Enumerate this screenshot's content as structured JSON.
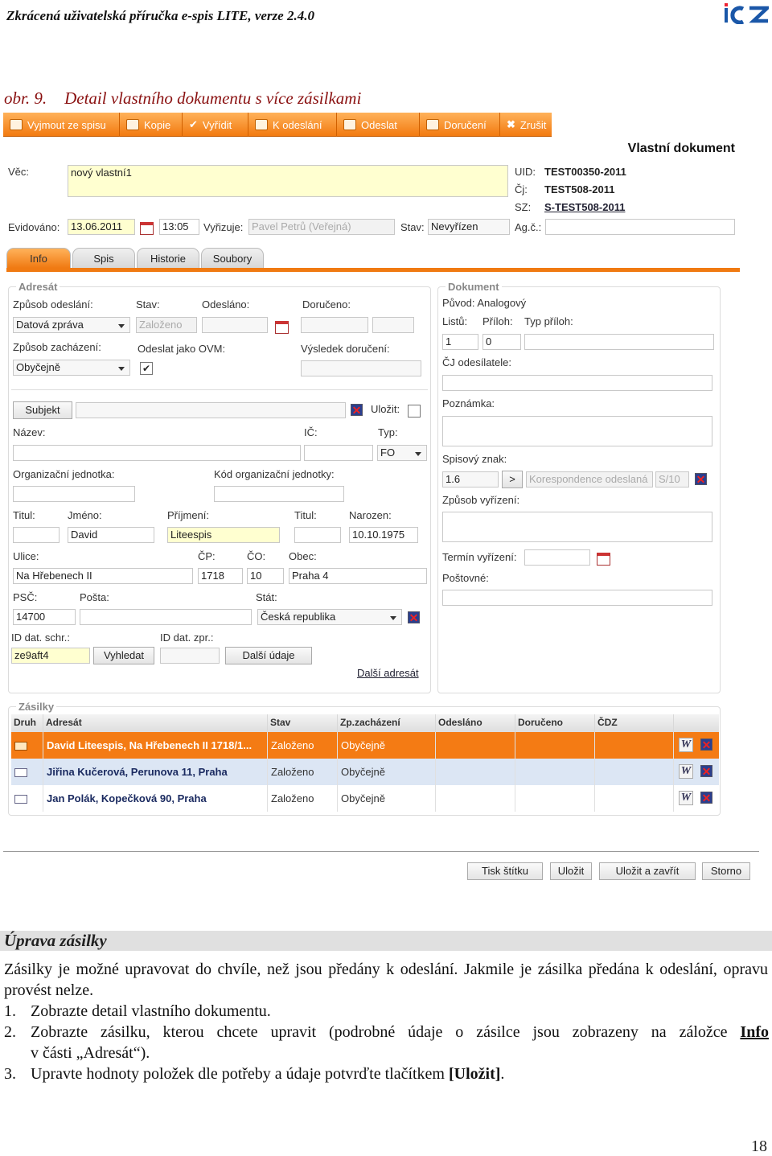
{
  "header": {
    "title": "Zkrácená uživatelská příručka e-spis LITE, verze 2.4.0",
    "logo": "ICZ"
  },
  "figure": {
    "number": "obr. 9.",
    "caption": "Detail vlastního dokumentu s více zásilkami"
  },
  "toolbar": [
    "Vyjmout ze spisu",
    "Kopie",
    "Vyřídit",
    "K odeslání",
    "Odeslat",
    "Doručení",
    "Zrušit"
  ],
  "doc": {
    "heading": "Vlastní dokument",
    "vec_label": "Věc:",
    "vec": "nový vlastní1",
    "uid_label": "UID:",
    "uid": "TEST00350-2011",
    "cj_label": "Čj:",
    "cj": "TEST508-2011",
    "sz_label": "SZ:",
    "sz": "S-TEST508-2011",
    "evid_label": "Evidováno:",
    "evid_date": "13.06.2011",
    "evid_time": "13:05",
    "vyrizuje_label": "Vyřizuje:",
    "vyrizuje": "Pavel Petrů (Veřejná)",
    "stav_label": "Stav:",
    "stav": "Nevyřízen",
    "agc_label": "Ag.č.:"
  },
  "tabs": [
    "Info",
    "Spis",
    "Historie",
    "Soubory"
  ],
  "adresat": {
    "title": "Adresát",
    "zpusob_odeslani_label": "Způsob odeslání:",
    "zpusob_odeslani": "Datová zpráva",
    "stav_label": "Stav:",
    "stav": "Založeno",
    "odeslano_label": "Odesláno:",
    "doruceno_label": "Doručeno:",
    "zpusob_zachazeni_label": "Způsob zacházení:",
    "zpusob_zachazeni": "Obyčejně",
    "ovm_label": "Odeslat jako OVM:",
    "vysledek_label": "Výsledek doručení:",
    "subjekt_btn": "Subjekt",
    "ulozit_label": "Uložit:",
    "nazev_label": "Název:",
    "ic_label": "IČ:",
    "typ_label": "Typ:",
    "typ": "FO",
    "org_label": "Organizační jednotka:",
    "kod_org_label": "Kód organizační jednotky:",
    "titul_label": "Titul:",
    "jmeno_label": "Jméno:",
    "jmeno": "David",
    "prijmeni_label": "Příjmení:",
    "prijmeni": "Liteespis",
    "titul2_label": "Titul:",
    "narozen_label": "Narozen:",
    "narozen": "10.10.1975",
    "ulice_label": "Ulice:",
    "ulice": "Na Hřebenech II",
    "cp_label": "ČP:",
    "cp": "1718",
    "co_label": "ČO:",
    "co": "10",
    "obec_label": "Obec:",
    "obec": "Praha 4",
    "psc_label": "PSČ:",
    "psc": "14700",
    "posta_label": "Pošta:",
    "stat_label": "Stát:",
    "stat": "Česká republika",
    "idschr_label": "ID dat. schr.:",
    "idschr": "ze9aft4",
    "vyhledat_btn": "Vyhledat",
    "idzpr_label": "ID dat. zpr.:",
    "dalsi_udaje_btn": "Další údaje",
    "dalsi_adresat": "Další adresát"
  },
  "dokument": {
    "title": "Dokument",
    "puvod": "Původ: Analogový",
    "listu_label": "Listů:",
    "priloh_label": "Příloh:",
    "typ_priloh_label": "Typ příloh:",
    "listu": "1",
    "priloh": "0",
    "cj_odesilatele_label": "ČJ odesílatele:",
    "poznamka_label": "Poznámka:",
    "spis_znak_label": "Spisový znak:",
    "spis_znak": "1.6",
    "spis_znak_btn": ">",
    "spis_znak_nazev": "Korespondence odeslaná",
    "spis_znak_lhuta": "S/10",
    "zpusob_vyrizeni_label": "Způsob vyřízení:",
    "termin_label": "Termín vyřízení:",
    "postovne_label": "Poštovné:"
  },
  "zasilky": {
    "title": "Zásilky",
    "columns": [
      "Druh",
      "Adresát",
      "Stav",
      "Zp.zacházení",
      "Odesláno",
      "Doručeno",
      "ČDZ"
    ],
    "rows": [
      {
        "adresat": "David Liteespis, Na Hřebenech II 1718/1...",
        "stav": "Založeno",
        "zachazeni": "Obyčejně"
      },
      {
        "adresat": "Jiřina Kučerová, Perunova 11, Praha",
        "stav": "Založeno",
        "zachazeni": "Obyčejně"
      },
      {
        "adresat": "Jan Polák, Kopečková 90, Praha",
        "stav": "Založeno",
        "zachazeni": "Obyčejně"
      }
    ]
  },
  "footer_buttons": [
    "Tisk štítku",
    "Uložit",
    "Uložit a zavřít",
    "Storno"
  ],
  "section": {
    "heading": "Úprava zásilky",
    "para": "Zásilky je možné upravovat do chvíle, než jsou předány k odeslání. Jakmile je zásilka předána k odeslání, opravu provést nelze.",
    "steps": [
      {
        "n": "1.",
        "text": "Zobrazte detail vlastního dokumentu."
      },
      {
        "n": "2.",
        "text": "Zobrazte zásilku, kterou chcete upravit (podrobné údaje o zásilce jsou zobrazeny na záložce ",
        "link": "Info",
        "text2": "v části „Adresát“)."
      },
      {
        "n": "3.",
        "text": "Upravte hodnoty položek dle potřeby a údaje potvrďte tlačítkem ",
        "bold": "[Uložit]",
        "text3": "."
      }
    ]
  },
  "page_number": "18"
}
